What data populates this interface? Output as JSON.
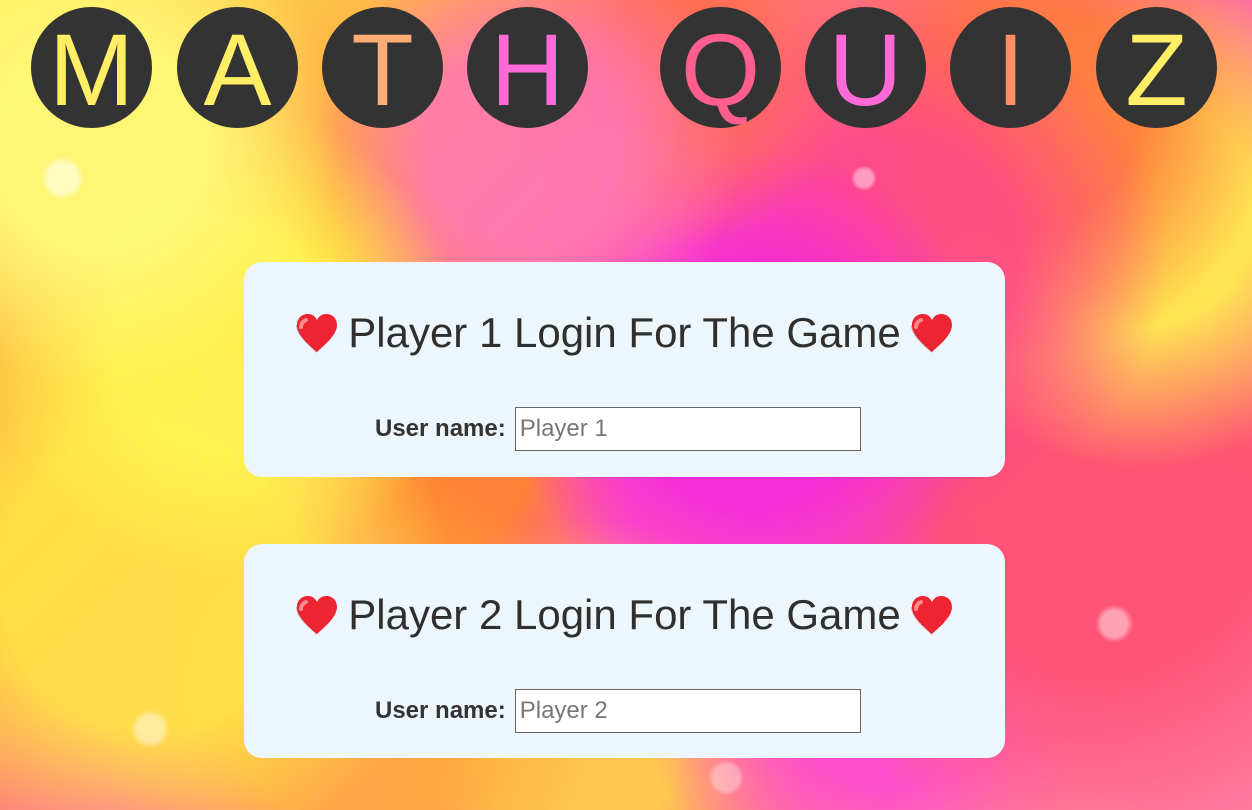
{
  "title": {
    "letters": [
      {
        "char": "M",
        "color": "#ffee66"
      },
      {
        "char": "A",
        "color": "#ffee66"
      },
      {
        "char": "T",
        "color": "#ffad74"
      },
      {
        "char": "H",
        "color": "#ff6ad7"
      },
      {
        "char": "Q",
        "color": "#ff5e8f"
      },
      {
        "char": "U",
        "color": "#ff6ad7"
      },
      {
        "char": "I",
        "color": "#ff8e66"
      },
      {
        "char": "Z",
        "color": "#ffee66"
      }
    ]
  },
  "cards": [
    {
      "heading": "Player 1 Login For The Game",
      "label": "User name:",
      "placeholder": "Player 1",
      "value": ""
    },
    {
      "heading": "Player 2 Login For The Game",
      "label": "User name:",
      "placeholder": "Player 2",
      "value": ""
    }
  ],
  "icons": {
    "heart": "heart-icon"
  },
  "colors": {
    "title_circle": "#333333",
    "card_background": "#eef6fd",
    "text": "#2f2f2f"
  }
}
